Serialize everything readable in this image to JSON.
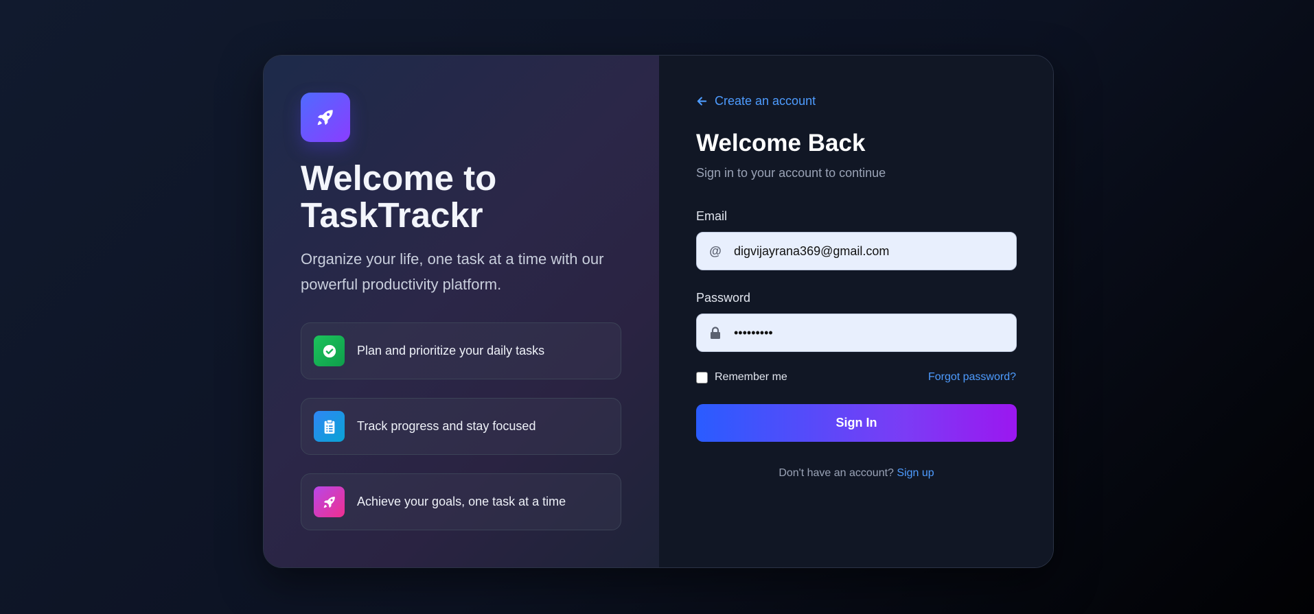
{
  "left": {
    "title": "Welcome to TaskTrackr",
    "subtitle": "Organize your life, one task at a time with our powerful productivity platform.",
    "logo_icon": "rocket-icon",
    "features": [
      {
        "label": "Plan and prioritize your daily tasks",
        "icon": "check-circle-icon",
        "color": "#16b257"
      },
      {
        "label": "Track progress and stay focused",
        "icon": "clipboard-icon",
        "color": "#1f8ce6"
      },
      {
        "label": "Achieve your goals, one task at a time",
        "icon": "rocket-icon",
        "color": "#d43ad6"
      }
    ]
  },
  "right": {
    "back_link": "Create an account",
    "title": "Welcome Back",
    "subtitle": "Sign in to your account to continue",
    "email_label": "Email",
    "email_value": "digvijayrana369@gmail.com",
    "email_icon": "@",
    "password_label": "Password",
    "password_value": "•••••••••",
    "remember_label": "Remember me",
    "forgot_label": "Forgot password?",
    "signin_label": "Sign In",
    "signup_prompt": "Don't have an account?",
    "signup_link": "Sign up"
  },
  "colors": {
    "accent_link": "#4e9cff",
    "button_start": "#2a5cff",
    "button_end": "#9b17f0"
  }
}
